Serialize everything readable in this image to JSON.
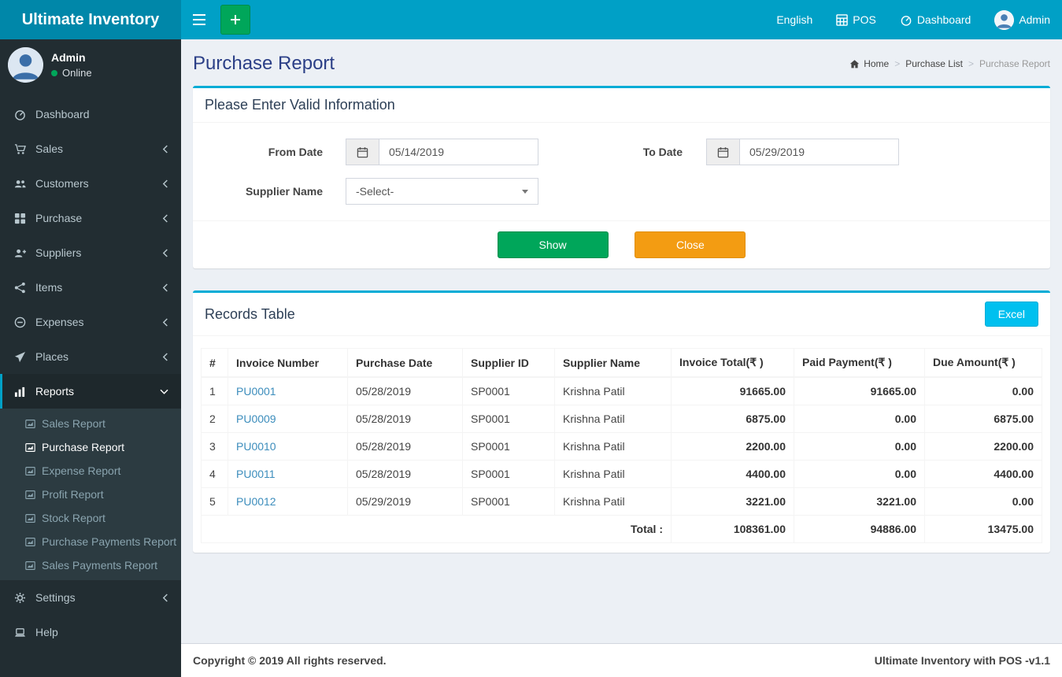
{
  "app": {
    "title": "Ultimate Inventory",
    "footer_left": "Copyright © 2019 All rights reserved.",
    "footer_right": "Ultimate Inventory with POS -v1.1"
  },
  "colors": {
    "navbar": "#00a0c6",
    "logo_bg": "#0087a9",
    "sidebar_bg": "#222d32",
    "submenu_bg": "#2c3b41",
    "accent_green": "#00a65a",
    "accent_orange": "#f39c12",
    "accent_cyan": "#00c0ef",
    "link_blue": "#3c8dbc",
    "box_top_border": "#00acd6"
  },
  "icons": [
    "menu-icon",
    "plus-icon",
    "calculator-icon",
    "tachometer-icon",
    "user-avatar",
    "shopping-cart-icon",
    "users-icon",
    "grid-icon",
    "user-plus-icon",
    "share-nodes-icon",
    "minus-circle-icon",
    "paper-plane-icon",
    "bar-chart-icon",
    "gear-icon",
    "laptop-icon",
    "file-chart-icon",
    "calendar-icon",
    "home-icon",
    "chevron-left-icon",
    "chevron-down-icon",
    "caret-down-icon",
    "online-dot"
  ],
  "navbar": {
    "language": "English",
    "pos": "POS",
    "dashboard": "Dashboard",
    "user": "Admin"
  },
  "sidebar": {
    "user": {
      "name": "Admin",
      "status": "Online"
    },
    "items": [
      {
        "label": "Dashboard"
      },
      {
        "label": "Sales"
      },
      {
        "label": "Customers"
      },
      {
        "label": "Purchase"
      },
      {
        "label": "Suppliers"
      },
      {
        "label": "Items"
      },
      {
        "label": "Expenses"
      },
      {
        "label": "Places"
      },
      {
        "label": "Reports"
      },
      {
        "label": "Settings"
      },
      {
        "label": "Help"
      }
    ],
    "reports_submenu": [
      "Sales Report",
      "Purchase Report",
      "Expense Report",
      "Profit Report",
      "Stock Report",
      "Purchase Payments Report",
      "Sales Payments Report"
    ]
  },
  "page": {
    "title": "Purchase Report",
    "breadcrumb": [
      "Home",
      "Purchase List",
      "Purchase Report"
    ]
  },
  "filter_box": {
    "title": "Please Enter Valid Information",
    "from_date_label": "From Date",
    "from_date_value": "05/14/2019",
    "to_date_label": "To Date",
    "to_date_value": "05/29/2019",
    "supplier_label": "Supplier Name",
    "supplier_value": "-Select-",
    "show_button": "Show",
    "close_button": "Close"
  },
  "records": {
    "title": "Records Table",
    "excel_button": "Excel",
    "columns": [
      "#",
      "Invoice Number",
      "Purchase Date",
      "Supplier ID",
      "Supplier Name",
      "Invoice Total(₹ )",
      "Paid Payment(₹ )",
      "Due Amount(₹ )"
    ],
    "rows": [
      [
        "1",
        "PU0001",
        "05/28/2019",
        "SP0001",
        "Krishna Patil",
        "91665.00",
        "91665.00",
        "0.00"
      ],
      [
        "2",
        "PU0009",
        "05/28/2019",
        "SP0001",
        "Krishna Patil",
        "6875.00",
        "0.00",
        "6875.00"
      ],
      [
        "3",
        "PU0010",
        "05/28/2019",
        "SP0001",
        "Krishna Patil",
        "2200.00",
        "0.00",
        "2200.00"
      ],
      [
        "4",
        "PU0011",
        "05/28/2019",
        "SP0001",
        "Krishna Patil",
        "4400.00",
        "0.00",
        "4400.00"
      ],
      [
        "5",
        "PU0012",
        "05/29/2019",
        "SP0001",
        "Krishna Patil",
        "3221.00",
        "3221.00",
        "0.00"
      ]
    ],
    "total_label": "Total :",
    "totals": [
      "108361.00",
      "94886.00",
      "13475.00"
    ]
  }
}
